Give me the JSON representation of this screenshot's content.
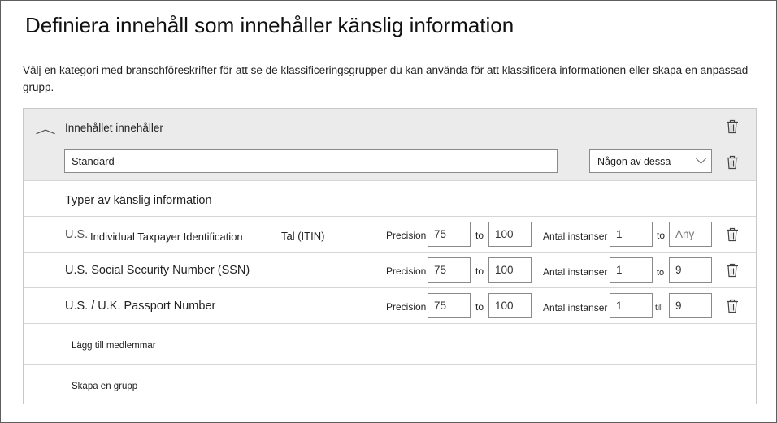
{
  "title": "Definiera innehåll som innehåller känslig information",
  "description": "Välj en kategori med branschföreskrifter för att se de klassificeringsgrupper du kan använda för att klassificera informationen eller skapa en anpassad grupp.",
  "group": {
    "header_label": "Innehållet innehåller",
    "name_value": "Standard",
    "match_select": "Någon av dessa",
    "types_heading": "Typer av känslig information"
  },
  "items": [
    {
      "name_prefix": "U.S.",
      "name": "Individual Taxpayer Identification",
      "name_suffix": "Tal (ITIN)",
      "precision_label": "Precision",
      "precision_min": "75",
      "to_label": "to",
      "precision_max": "100",
      "instances_label": "Antal instanser",
      "instances_min": "1",
      "instances_to_label": "to",
      "instances_max": "Any"
    },
    {
      "name": "U.S. Social Security Number (SSN)",
      "precision_label": "Precision",
      "precision_min": "75",
      "to_label": "to",
      "precision_max": "100",
      "instances_label": "Antal instanser",
      "instances_min": "1",
      "instances_to_label": "to",
      "instances_max": "9"
    },
    {
      "name": "U.S. / U.K. Passport Number",
      "precision_label": "Precision",
      "precision_min": "75",
      "to_label": "to",
      "precision_max": "100",
      "instances_label": "Antal instanser",
      "instances_min": "1",
      "instances_to_label": "till",
      "instances_max": "9"
    }
  ],
  "actions": {
    "add_members": "Lägg till medlemmar",
    "create_group": "Skapa en grupp"
  },
  "icons": {
    "collapse": "chevron-up-icon",
    "delete": "trash-icon"
  }
}
